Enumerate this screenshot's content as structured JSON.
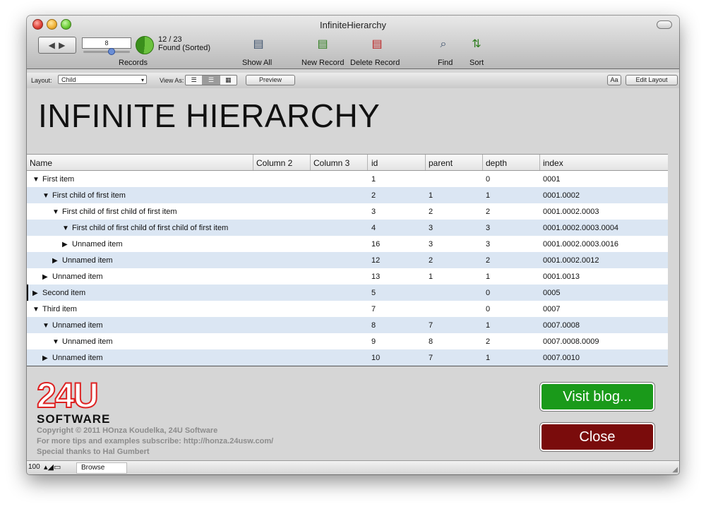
{
  "window": {
    "title": "InfiniteHierarchy"
  },
  "toolbar": {
    "record_slider_value": "8",
    "record_count": "12 / 23",
    "found_status": "Found (Sorted)",
    "records_label": "Records",
    "show_all_label": "Show All",
    "new_record_label": "New Record",
    "delete_record_label": "Delete Record",
    "find_label": "Find",
    "sort_label": "Sort"
  },
  "layoutbar": {
    "layout_label": "Layout:",
    "layout_value": "Child",
    "view_as_label": "View As:",
    "preview_label": "Preview",
    "format_label": "Aa",
    "edit_layout_label": "Edit Layout"
  },
  "main": {
    "title": "INFINITE HIERARCHY"
  },
  "table": {
    "headers": [
      "Name",
      "Column 2",
      "Column 3",
      "id",
      "parent",
      "depth",
      "index"
    ],
    "rows": [
      {
        "name": "First item",
        "tri": "▼",
        "level": 0,
        "id": "1",
        "parent": "",
        "depth": "0",
        "index": "0001"
      },
      {
        "name": "First child of first item",
        "tri": "▼",
        "level": 1,
        "id": "2",
        "parent": "1",
        "depth": "1",
        "index": "0001.0002"
      },
      {
        "name": "First child of first child of first item",
        "tri": "▼",
        "level": 2,
        "id": "3",
        "parent": "2",
        "depth": "2",
        "index": "0001.0002.0003"
      },
      {
        "name": "First child of first child of first child of first item",
        "tri": "▼",
        "level": 3,
        "id": "4",
        "parent": "3",
        "depth": "3",
        "index": "0001.0002.0003.0004"
      },
      {
        "name": "Unnamed item",
        "tri": "▶",
        "level": 3,
        "id": "16",
        "parent": "3",
        "depth": "3",
        "index": "0001.0002.0003.0016"
      },
      {
        "name": "Unnamed item",
        "tri": "▶",
        "level": 2,
        "id": "12",
        "parent": "2",
        "depth": "2",
        "index": "0001.0002.0012"
      },
      {
        "name": "Unnamed item",
        "tri": "▶",
        "level": 1,
        "id": "13",
        "parent": "1",
        "depth": "1",
        "index": "0001.0013"
      },
      {
        "name": "Second item",
        "tri": "▶",
        "level": 0,
        "id": "5",
        "parent": "",
        "depth": "0",
        "index": "0005",
        "current": true
      },
      {
        "name": "Third item",
        "tri": "▼",
        "level": 0,
        "id": "7",
        "parent": "",
        "depth": "0",
        "index": "0007"
      },
      {
        "name": "Unnamed item",
        "tri": "▼",
        "level": 1,
        "id": "8",
        "parent": "7",
        "depth": "1",
        "index": "0007.0008"
      },
      {
        "name": "Unnamed item",
        "tri": "▼",
        "level": 2,
        "id": "9",
        "parent": "8",
        "depth": "2",
        "index": "0007.0008.0009"
      },
      {
        "name": "Unnamed item",
        "tri": "▶",
        "level": 1,
        "id": "10",
        "parent": "7",
        "depth": "1",
        "index": "0007.0010"
      }
    ]
  },
  "footer": {
    "logo_number": "24U",
    "logo_word": "SOFTWARE",
    "copyright": "Copyright © 2011 HOnza Koudelka, 24U Software",
    "subscribe": "For more tips and examples subscribe: http://honza.24usw.com/",
    "thanks": "Special thanks to Hal Gumbert",
    "visit_blog_label": "Visit blog...",
    "close_label": "Close"
  },
  "statusbar": {
    "zoom": "100",
    "mode": "Browse"
  },
  "colors": {
    "row_alt": "#dbe6f3",
    "blog_button": "#1a9a1a",
    "close_button": "#7a0c0c",
    "logo_red": "#dd2222"
  }
}
